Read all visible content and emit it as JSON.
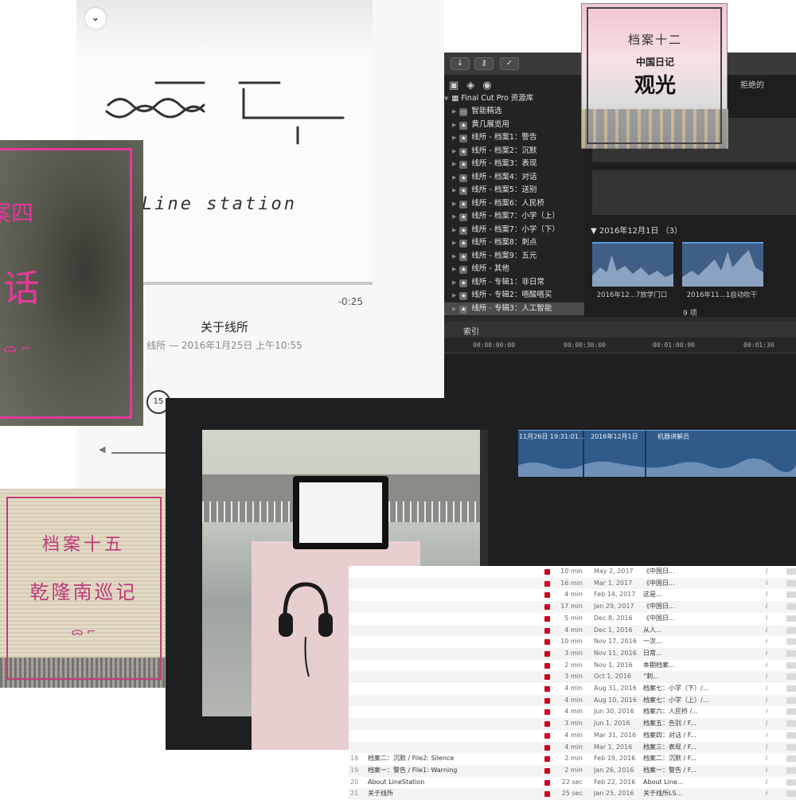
{
  "player": {
    "brand": "Line station",
    "remaining": "-0:25",
    "episode_title": "关于线所",
    "episode_subtitle": "线所 — 2016年1月25日 上午10:55",
    "skip_back": "15",
    "down_icon": "chevron-down-icon"
  },
  "fcp": {
    "library_title": "Final Cut Pro 资源库",
    "browser_filter": "拒绝的",
    "sidebar": [
      {
        "label": "智能精选",
        "kind": "folder"
      },
      {
        "label": "黄几展览用",
        "kind": "event"
      },
      {
        "label": "线所 - 档案1：警告",
        "kind": "event"
      },
      {
        "label": "线所 - 档案2：沉默",
        "kind": "event"
      },
      {
        "label": "线所 - 档案3：表现",
        "kind": "event"
      },
      {
        "label": "线所 - 档案4：对话",
        "kind": "event"
      },
      {
        "label": "线所 - 档案5：送别",
        "kind": "event"
      },
      {
        "label": "线所 - 档案6：人民桥",
        "kind": "event"
      },
      {
        "label": "线所 - 档案7：小学（上）",
        "kind": "event"
      },
      {
        "label": "线所 - 档案7：小学（下）",
        "kind": "event"
      },
      {
        "label": "线所 - 档案8：刺点",
        "kind": "event"
      },
      {
        "label": "线所 - 档案9：五元",
        "kind": "event"
      },
      {
        "label": "线所 - 其他",
        "kind": "event"
      },
      {
        "label": "线所 - 专辑1：非日常",
        "kind": "event"
      },
      {
        "label": "线所 - 专辑2：唔酸唔买",
        "kind": "event"
      },
      {
        "label": "线所 - 专辑3：人工智能",
        "kind": "event",
        "selected": true
      }
    ],
    "date_group": "2016年12月1日",
    "date_group_count": "（3）",
    "clips": [
      {
        "label": "2016年12...7放学门口"
      },
      {
        "label": "2016年11...1自动吹干"
      }
    ],
    "item_count": "9 项",
    "index_label": "索引",
    "timecodes": [
      "00:00:00:00",
      "00:00:30:00",
      "00:01:00:00",
      "00:01:30"
    ],
    "timeline_segments": [
      "11月26日 19:31:01...",
      "2016年12月1日",
      "机器讲解员"
    ]
  },
  "cover12": {
    "title": "档案十二",
    "series": "中国日记",
    "name": "观光"
  },
  "cover4": {
    "title": "案四",
    "name": "话",
    "mark": "ᯅ ⌐"
  },
  "cover15": {
    "title": "档案十五",
    "name": "乾隆南巡记",
    "mark": "ᯅ ⌐"
  },
  "list": [
    {
      "num": "",
      "name": "",
      "dur": "10 min",
      "date": "May 2, 2017",
      "desc": "《中国日..."
    },
    {
      "num": "",
      "name": "",
      "dur": "16 min",
      "date": "Mar 1, 2017",
      "desc": "《中国日..."
    },
    {
      "num": "",
      "name": "",
      "dur": "4 min",
      "date": "Feb 14, 2017",
      "desc": "这是..."
    },
    {
      "num": "",
      "name": "",
      "dur": "17 min",
      "date": "Jan 29, 2017",
      "desc": "《中国日..."
    },
    {
      "num": "",
      "name": "",
      "dur": "5 min",
      "date": "Dec 8, 2016",
      "desc": "《中国日..."
    },
    {
      "num": "",
      "name": "",
      "dur": "4 min",
      "date": "Dec 1, 2016",
      "desc": "从人..."
    },
    {
      "num": "",
      "name": "",
      "dur": "10 min",
      "date": "Nov 17, 2016",
      "desc": "一次..."
    },
    {
      "num": "",
      "name": "",
      "dur": "3 min",
      "date": "Nov 11, 2016",
      "desc": "日常..."
    },
    {
      "num": "",
      "name": "",
      "dur": "2 min",
      "date": "Nov 1, 2016",
      "desc": "本期档案..."
    },
    {
      "num": "",
      "name": "",
      "dur": "3 min",
      "date": "Oct 1, 2016",
      "desc": "“刺..."
    },
    {
      "num": "",
      "name": "",
      "dur": "4 min",
      "date": "Aug 31, 2016",
      "desc": "档案七：小学（下）/..."
    },
    {
      "num": "",
      "name": "",
      "dur": "4 min",
      "date": "Aug 10, 2016",
      "desc": "档案七：小学（上）/..."
    },
    {
      "num": "",
      "name": "",
      "dur": "4 min",
      "date": "Jun 30, 2016",
      "desc": "档案六：人民桥 /..."
    },
    {
      "num": "",
      "name": "",
      "dur": "3 min",
      "date": "Jun 1, 2016",
      "desc": "档案五：告别 / F..."
    },
    {
      "num": "",
      "name": "",
      "dur": "4 min",
      "date": "Mar 31, 2016",
      "desc": "档案四：对话 / F..."
    },
    {
      "num": "",
      "name": "",
      "dur": "4 min",
      "date": "Mar 1, 2016",
      "desc": "档案三：表现 / F..."
    },
    {
      "num": "18",
      "name": "档案二：沉默 / File2: Silence",
      "dur": "2 min",
      "date": "Feb 19, 2016",
      "desc": "档案二：沉默 / F..."
    },
    {
      "num": "19",
      "name": "档案一：警告 / File1: Warning",
      "dur": "2 min",
      "date": "Jan 26, 2016",
      "desc": "档案一：警告 / F..."
    },
    {
      "num": "20",
      "name": "About LineStation",
      "dur": "22 sec",
      "date": "Feb 22, 2016",
      "desc": "About Line..."
    },
    {
      "num": "21",
      "name": "关于线所",
      "dur": "25 sec",
      "date": "Jan 25, 2016",
      "desc": "关于线所LS..."
    }
  ],
  "colors": {
    "pink": "#e5399a",
    "fcp_blue": "#3f5f86",
    "itunes_red": "#d0021b"
  }
}
